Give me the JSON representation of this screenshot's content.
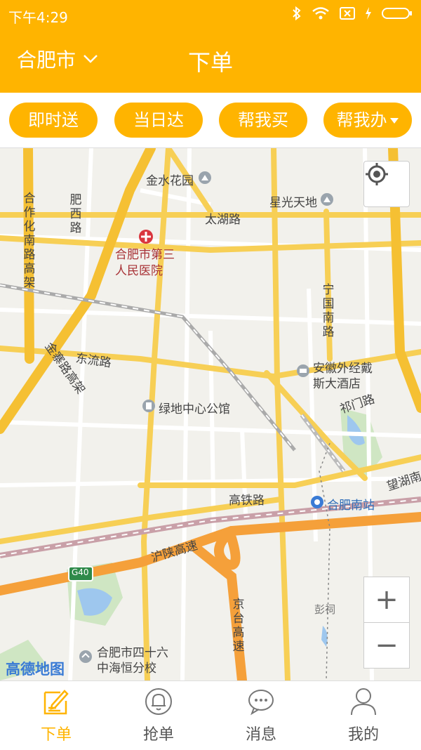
{
  "status": {
    "time": "下午4:29"
  },
  "header": {
    "city": "合肥市",
    "title": "下单"
  },
  "services": [
    "即时送",
    "当日达",
    "帮我买",
    "帮我办"
  ],
  "map": {
    "logo": "高德地图",
    "labels": {
      "jinshui": "金水花园",
      "xingguang": "星光天地",
      "feixi": "肥西路",
      "hezuohua": "合作化南路高架",
      "taihu": "太湖路",
      "hospital_line1": "合肥市第三",
      "hospital_line2": "人民医院",
      "ningguo": "宁国南路",
      "jinzhai": "金寨路高架",
      "dongliu": "东流路",
      "hotel_line1": "安徽外经戴",
      "hotel_line2": "斯大酒店",
      "lvdi": "绿地中心公馆",
      "qimen": "祁门路",
      "wanghu": "望湖南",
      "gaotie": "高铁路",
      "hefeinan": "合肥南站",
      "hushan": "沪陕高速",
      "g40": "G40",
      "jingtai": "京台高速",
      "pengci": "彭祠",
      "school_line1": "合肥市四十六",
      "school_line2": "中海恒分校"
    },
    "zoom_in": "+",
    "zoom_out": "−"
  },
  "tabs": [
    {
      "label": "下单",
      "icon": "order-edit-icon",
      "active": true
    },
    {
      "label": "抢单",
      "icon": "bell-icon",
      "active": false
    },
    {
      "label": "消息",
      "icon": "message-icon",
      "active": false
    },
    {
      "label": "我的",
      "icon": "user-icon",
      "active": false
    }
  ],
  "colors": {
    "brand": "#ffb400",
    "highway": "#f5a03a",
    "arterial": "#f7cf55"
  }
}
